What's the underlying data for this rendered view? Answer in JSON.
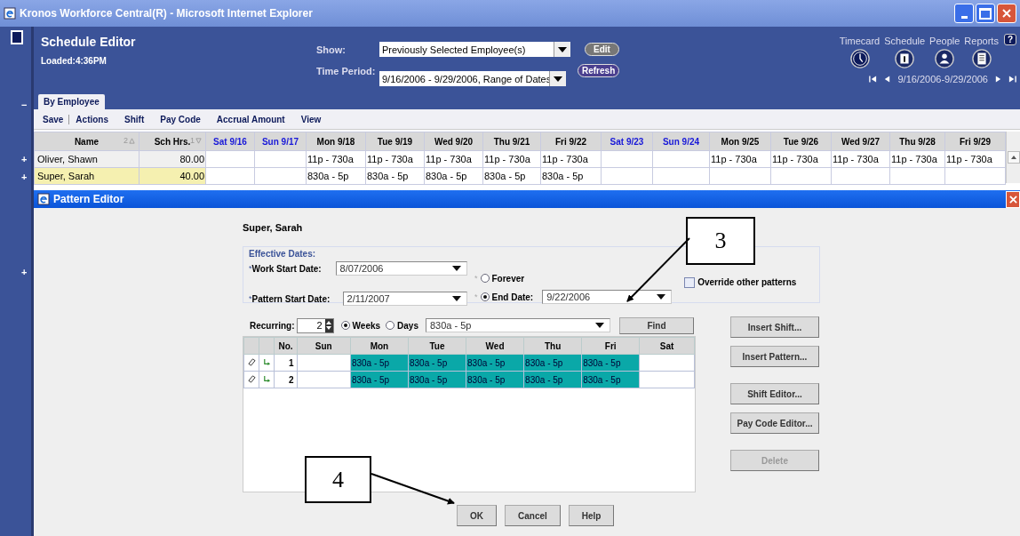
{
  "window": {
    "title": "Kronos Workforce Central(R) - Microsoft Internet Explorer"
  },
  "header": {
    "title": "Schedule Editor",
    "loaded": "Loaded:4:36PM",
    "show_label": "Show:",
    "show_value": "Previously Selected Employee(s)",
    "edit_button": "Edit",
    "period_label": "Time Period:",
    "period_value": "9/16/2006 - 9/29/2006, Range of Dates",
    "refresh_button": "Refresh",
    "help": "?",
    "nav": [
      {
        "label": "Timecard",
        "kind": "clock"
      },
      {
        "label": "Schedule",
        "kind": "calendar"
      },
      {
        "label": "People",
        "kind": "person"
      },
      {
        "label": "Reports",
        "kind": "report"
      }
    ],
    "range": "9/16/2006-9/29/2006"
  },
  "tabs": [
    {
      "label": "By Employee",
      "selected": true
    }
  ],
  "toolbar": [
    "Save",
    "Actions",
    "Shift",
    "Pay Code",
    "Accrual Amount",
    "View"
  ],
  "strip": {
    "collapse": "−"
  },
  "grid": {
    "columns": [
      {
        "label": "Name",
        "sort": "2",
        "weekend": false
      },
      {
        "label": "Sch Hrs.",
        "sort": "1",
        "weekend": false
      },
      {
        "label": "Sat 9/16",
        "weekend": true
      },
      {
        "label": "Sun 9/17",
        "weekend": true
      },
      {
        "label": "Mon 9/18",
        "weekend": false
      },
      {
        "label": "Tue 9/19",
        "weekend": false
      },
      {
        "label": "Wed 9/20",
        "weekend": false
      },
      {
        "label": "Thu 9/21",
        "weekend": false
      },
      {
        "label": "Fri 9/22",
        "weekend": false
      },
      {
        "label": "Sat 9/23",
        "weekend": true
      },
      {
        "label": "Sun 9/24",
        "weekend": true
      },
      {
        "label": "Mon 9/25",
        "weekend": false
      },
      {
        "label": "Tue 9/26",
        "weekend": false
      },
      {
        "label": "Wed 9/27",
        "weekend": false
      },
      {
        "label": "Thu 9/28",
        "weekend": false
      },
      {
        "label": "Fri 9/29",
        "weekend": false
      }
    ],
    "rows": [
      {
        "toggle": "+",
        "selected": false,
        "cells": [
          "Oliver, Shawn",
          "80.00",
          "",
          "",
          "11p - 730a",
          "11p - 730a",
          "11p - 730a",
          "11p - 730a",
          "11p - 730a",
          "",
          "",
          "11p - 730a",
          "11p - 730a",
          "11p - 730a",
          "11p - 730a",
          "11p - 730a"
        ]
      },
      {
        "toggle": "+",
        "selected": true,
        "cells": [
          "Super, Sarah",
          "40.00",
          "",
          "",
          "830a - 5p",
          "830a - 5p",
          "830a - 5p",
          "830a - 5p",
          "830a - 5p",
          "",
          "",
          "",
          "",
          "",
          "",
          ""
        ]
      }
    ]
  },
  "dialog": {
    "title": "Pattern Editor",
    "toggle": "+",
    "employee": "Super, Sarah",
    "legend": "Effective Dates:",
    "work_start_mark": "*",
    "pattern_start_mark": "*",
    "work_start_label": "Work Start Date:",
    "work_start": "8/07/2006",
    "pattern_start_label": "Pattern Start Date:",
    "pattern_start": "2/11/2007",
    "end_options": [
      {
        "mark": "*",
        "label": "Forever",
        "selected": false
      },
      {
        "mark": "*",
        "label": "End Date:",
        "selected": true
      }
    ],
    "end_date": "9/22/2006",
    "override": {
      "label": "Override other patterns",
      "checked": false
    },
    "recurring_label": "Recurring:",
    "recurring": "2",
    "units": [
      {
        "label": "Weeks",
        "selected": true
      },
      {
        "label": "Days",
        "selected": false
      }
    ],
    "shift": "830a - 5p",
    "find": "Find",
    "columns": [
      "No.",
      "Sun",
      "Mon",
      "Tue",
      "Wed",
      "Thu",
      "Fri",
      "Sat"
    ],
    "rows": [
      {
        "cells": [
          "1",
          "",
          "830a - 5p",
          "830a - 5p",
          "830a - 5p",
          "830a - 5p",
          "830a - 5p",
          ""
        ]
      },
      {
        "cells": [
          "2",
          "",
          "830a - 5p",
          "830a - 5p",
          "830a - 5p",
          "830a - 5p",
          "830a - 5p",
          ""
        ]
      }
    ],
    "side_buttons": [
      {
        "label": "Insert Shift...",
        "disabled": false
      },
      {
        "label": "Insert Pattern...",
        "disabled": false
      },
      {
        "label": "Shift Editor...",
        "disabled": false
      },
      {
        "label": "Pay Code Editor...",
        "disabled": false
      },
      {
        "label": "Delete",
        "disabled": true
      }
    ],
    "buttons": [
      "OK",
      "Cancel",
      "Help"
    ]
  },
  "callouts": [
    {
      "label": "3"
    },
    {
      "label": "4"
    }
  ]
}
